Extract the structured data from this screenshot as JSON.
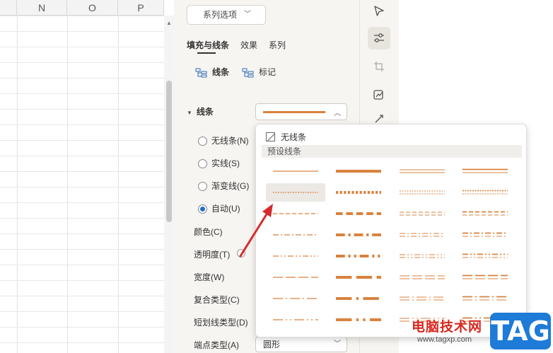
{
  "sheet": {
    "columns": [
      "N",
      "O",
      "P"
    ]
  },
  "panel": {
    "series_dropdown": "系列选项",
    "tabs": [
      "填充与线条",
      "效果",
      "系列"
    ],
    "subtabs": [
      "线条",
      "标记"
    ],
    "section_line": "线条",
    "radio_options": [
      {
        "label": "无线条(N)",
        "checked": false
      },
      {
        "label": "实线(S)",
        "checked": false
      },
      {
        "label": "渐变线(G)",
        "checked": false
      },
      {
        "label": "自动(U)",
        "checked": true
      }
    ],
    "props": {
      "color": "颜色(C)",
      "transparency": "透明度(T)",
      "width": "宽度(W)",
      "compound": "复合类型(C)",
      "dash": "短划线类型(D)",
      "cap": "端点类型(A)",
      "cap_value": "圆形"
    }
  },
  "dropdown": {
    "no_line": "无线条",
    "preset_header": "预设线条",
    "line_color": "#d9823e",
    "selected_index": 4
  },
  "watermark": {
    "text": "电脑技术网",
    "url": "www.tagxp.com",
    "tag": "TAG"
  },
  "colors": {
    "accent_line": "#d9823e",
    "arrow": "#d62b2b",
    "radio_on": "#1f6fd0"
  }
}
